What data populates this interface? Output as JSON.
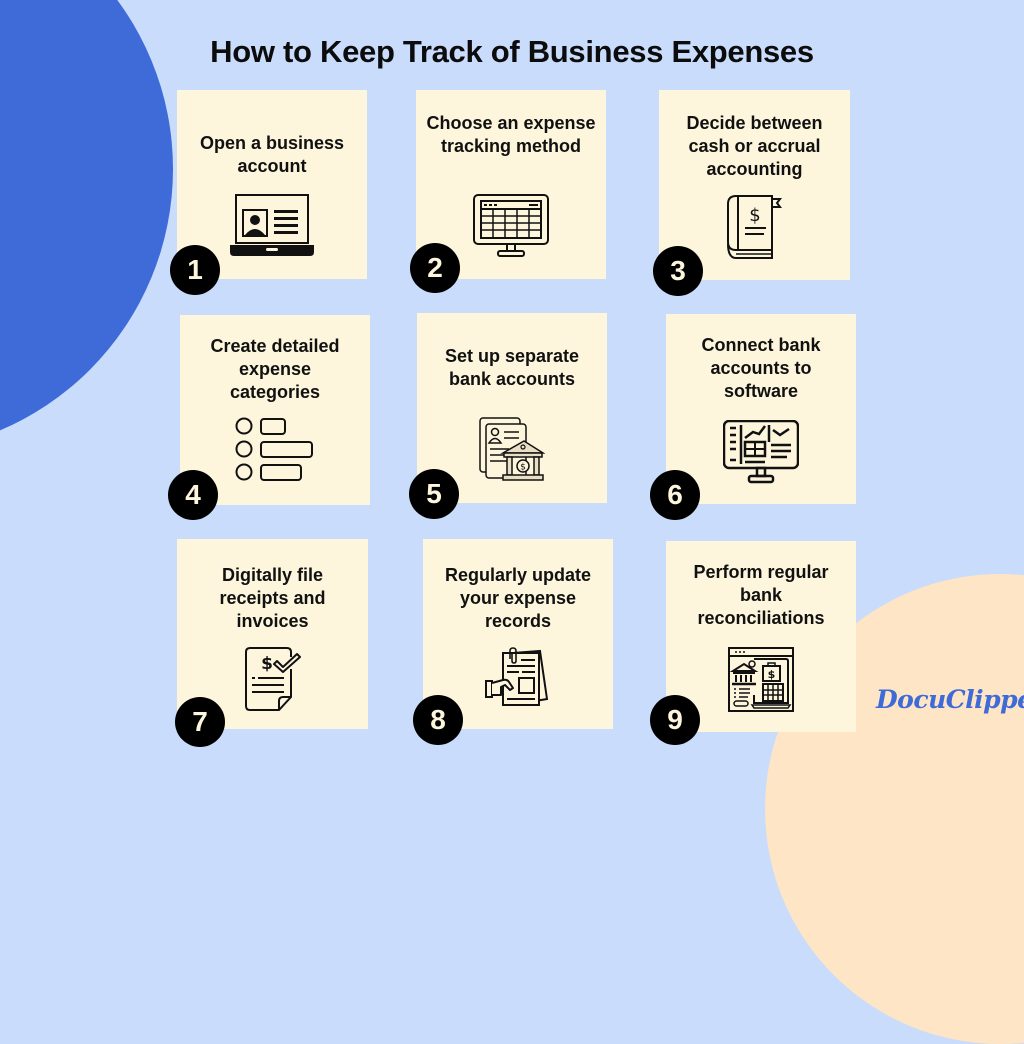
{
  "title": "How to Keep Track of Business Expenses",
  "steps": [
    {
      "number": "1",
      "text": "Open a business account",
      "icon": "laptop-profile-icon"
    },
    {
      "number": "2",
      "text": "Choose an expense tracking method",
      "icon": "spreadsheet-monitor-icon"
    },
    {
      "number": "3",
      "text": "Decide between cash or accrual accounting",
      "icon": "ledger-book-icon"
    },
    {
      "number": "4",
      "text": "Create detailed expense categories",
      "icon": "category-list-icon"
    },
    {
      "number": "5",
      "text": "Set up separate bank accounts",
      "icon": "bank-documents-icon"
    },
    {
      "number": "6",
      "text": "Connect bank accounts to software",
      "icon": "dashboard-monitor-icon"
    },
    {
      "number": "7",
      "text": "Digitally file receipts and invoices",
      "icon": "receipt-check-icon"
    },
    {
      "number": "8",
      "text": "Regularly update your expense records",
      "icon": "records-hand-icon"
    },
    {
      "number": "9",
      "text": "Perform regular bank reconciliations",
      "icon": "bank-reconciliation-icon"
    }
  ],
  "brand": {
    "logo_text": "DocuClipper",
    "colors": {
      "background": "#c9dcfc",
      "accent_blue": "#3f6bd8",
      "peach": "#fde5c6",
      "card": "#fdf6dd"
    }
  }
}
